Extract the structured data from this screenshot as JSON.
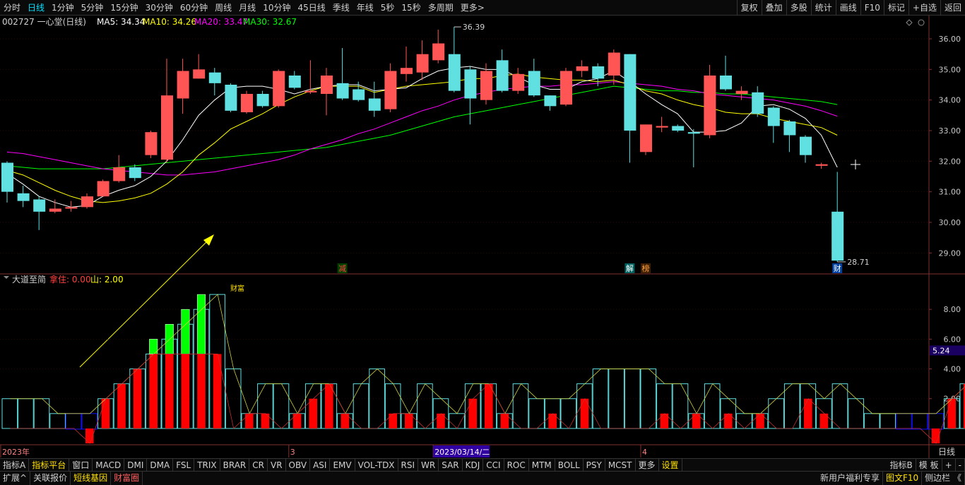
{
  "top_menu": [
    "分时",
    "日线",
    "1分钟",
    "5分钟",
    "15分钟",
    "30分钟",
    "60分钟",
    "周线",
    "月线",
    "10分钟",
    "45日线",
    "季线",
    "年线",
    "5秒",
    "15秒",
    "多周期",
    "更多>"
  ],
  "top_menu_active": "日线",
  "top_right": [
    "复权",
    "叠加",
    "多股",
    "统计",
    "画线",
    "F10",
    "标记",
    "+自选",
    "返回"
  ],
  "header": {
    "stock": "002727 一心堂(日线)",
    "ma5": "MA5: 34.34",
    "ma10": "MA10: 34.26",
    "ma20": "MA20: 33.47",
    "ma30": "MA30: 32.67"
  },
  "colors": {
    "up": "#ff5555",
    "down": "#60e0e0",
    "ma5": "#ffffff",
    "ma10": "#ffff00",
    "ma20": "#ff00ff",
    "ma30": "#00ff00",
    "red_bar": "#ff0000",
    "green_bar": "#00ff00",
    "blue_box": "#1010ff"
  },
  "chart_data": {
    "type": "candlestick",
    "price_axis": {
      "min": 28.5,
      "max": 36.3,
      "ticks": [
        "36.00",
        "35.00",
        "34.00",
        "33.00",
        "32.00",
        "31.00",
        "30.00",
        "29.00"
      ]
    },
    "high_label": "36.39",
    "low_label": "28.71",
    "candles": [
      {
        "o": 31.95,
        "c": 31.0,
        "h": 32.0,
        "l": 30.65
      },
      {
        "o": 30.95,
        "c": 30.7,
        "h": 31.2,
        "l": 30.5
      },
      {
        "o": 30.75,
        "c": 30.35,
        "h": 30.85,
        "l": 29.75
      },
      {
        "o": 30.35,
        "c": 30.45,
        "h": 30.75,
        "l": 30.3
      },
      {
        "o": 30.45,
        "c": 30.5,
        "h": 30.7,
        "l": 30.35
      },
      {
        "o": 30.5,
        "c": 30.85,
        "h": 30.95,
        "l": 30.45
      },
      {
        "o": 30.85,
        "c": 31.35,
        "h": 31.4,
        "l": 30.85
      },
      {
        "o": 31.35,
        "c": 31.8,
        "h": 32.2,
        "l": 31.3
      },
      {
        "o": 31.8,
        "c": 31.45,
        "h": 31.9,
        "l": 31.35
      },
      {
        "o": 32.2,
        "c": 32.95,
        "h": 33.0,
        "l": 32.1
      },
      {
        "o": 32.05,
        "c": 34.15,
        "h": 35.35,
        "l": 31.95
      },
      {
        "o": 34.05,
        "c": 34.95,
        "h": 35.35,
        "l": 33.55
      },
      {
        "o": 34.7,
        "c": 35.0,
        "h": 35.5,
        "l": 34.7
      },
      {
        "o": 34.9,
        "c": 34.55,
        "h": 35.05,
        "l": 34.15
      },
      {
        "o": 34.5,
        "c": 33.65,
        "h": 34.55,
        "l": 33.6
      },
      {
        "o": 33.6,
        "c": 34.2,
        "h": 34.3,
        "l": 33.55
      },
      {
        "o": 34.2,
        "c": 33.8,
        "h": 34.3,
        "l": 33.75
      },
      {
        "o": 33.8,
        "c": 34.95,
        "h": 35.0,
        "l": 33.75
      },
      {
        "o": 34.8,
        "c": 34.4,
        "h": 34.95,
        "l": 34.35
      },
      {
        "o": 34.25,
        "c": 34.3,
        "h": 35.3,
        "l": 34.2
      },
      {
        "o": 34.2,
        "c": 34.8,
        "h": 35.05,
        "l": 33.5
      },
      {
        "o": 34.55,
        "c": 34.05,
        "h": 35.7,
        "l": 34.0
      },
      {
        "o": 34.35,
        "c": 34.0,
        "h": 34.6,
        "l": 33.95
      },
      {
        "o": 34.05,
        "c": 33.65,
        "h": 34.6,
        "l": 33.45
      },
      {
        "o": 33.7,
        "c": 34.95,
        "h": 35.2,
        "l": 33.6
      },
      {
        "o": 34.85,
        "c": 35.05,
        "h": 35.75,
        "l": 34.6
      },
      {
        "o": 34.9,
        "c": 35.5,
        "h": 35.95,
        "l": 34.65
      },
      {
        "o": 35.3,
        "c": 35.85,
        "h": 36.3,
        "l": 35.2
      },
      {
        "o": 35.5,
        "c": 34.3,
        "h": 36.39,
        "l": 34.25
      },
      {
        "o": 35.0,
        "c": 34.05,
        "h": 35.1,
        "l": 33.2
      },
      {
        "o": 34.0,
        "c": 34.95,
        "h": 35.2,
        "l": 33.85
      },
      {
        "o": 35.3,
        "c": 34.3,
        "h": 35.65,
        "l": 34.25
      },
      {
        "o": 34.3,
        "c": 34.85,
        "h": 35.05,
        "l": 34.2
      },
      {
        "o": 34.95,
        "c": 34.15,
        "h": 35.35,
        "l": 34.1
      },
      {
        "o": 34.15,
        "c": 33.8,
        "h": 34.15,
        "l": 33.65
      },
      {
        "o": 33.85,
        "c": 34.95,
        "h": 35.05,
        "l": 33.8
      },
      {
        "o": 34.95,
        "c": 35.1,
        "h": 35.3,
        "l": 34.75
      },
      {
        "o": 35.1,
        "c": 34.7,
        "h": 35.2,
        "l": 34.45
      },
      {
        "o": 34.8,
        "c": 35.55,
        "h": 35.65,
        "l": 34.5
      },
      {
        "o": 35.5,
        "c": 33.0,
        "h": 35.5,
        "l": 31.95
      },
      {
        "o": 32.3,
        "c": 33.2,
        "h": 33.2,
        "l": 32.2
      },
      {
        "o": 33.1,
        "c": 33.15,
        "h": 33.45,
        "l": 32.95
      },
      {
        "o": 33.15,
        "c": 33.0,
        "h": 33.2,
        "l": 32.95
      },
      {
        "o": 32.95,
        "c": 32.9,
        "h": 33.05,
        "l": 31.8
      },
      {
        "o": 32.85,
        "c": 34.8,
        "h": 35.15,
        "l": 32.75
      },
      {
        "o": 34.8,
        "c": 34.35,
        "h": 35.45,
        "l": 34.3
      },
      {
        "o": 34.2,
        "c": 34.3,
        "h": 34.45,
        "l": 34.0
      },
      {
        "o": 34.25,
        "c": 33.55,
        "h": 34.45,
        "l": 33.45
      },
      {
        "o": 33.75,
        "c": 33.15,
        "h": 33.8,
        "l": 32.6
      },
      {
        "o": 33.3,
        "c": 32.85,
        "h": 33.35,
        "l": 32.3
      },
      {
        "o": 32.8,
        "c": 32.2,
        "h": 32.85,
        "l": 31.95
      },
      {
        "o": 31.85,
        "c": 31.9,
        "h": 31.95,
        "l": 31.75
      },
      {
        "o": 30.35,
        "c": 28.75,
        "h": 31.65,
        "l": 28.71
      }
    ],
    "ma5": [
      31.6,
      31.25,
      30.85,
      30.65,
      30.5,
      30.55,
      30.85,
      31.05,
      31.2,
      31.5,
      32.0,
      32.7,
      33.5,
      34.0,
      34.4,
      34.45,
      34.45,
      34.35,
      34.2,
      34.35,
      34.45,
      34.5,
      34.5,
      34.3,
      34.35,
      34.4,
      34.7,
      34.95,
      35.05,
      35.1,
      35.0,
      35.0,
      34.75,
      34.5,
      34.35,
      34.35,
      34.6,
      34.7,
      34.95,
      34.6,
      34.2,
      33.85,
      33.55,
      32.95,
      32.95,
      33.0,
      33.25,
      33.8,
      33.85,
      33.7,
      33.4,
      32.85,
      31.8
    ],
    "ma10": [
      31.7,
      31.55,
      31.3,
      31.05,
      30.85,
      30.7,
      30.65,
      30.7,
      30.8,
      30.95,
      31.25,
      31.65,
      32.2,
      32.6,
      33.05,
      33.3,
      33.55,
      33.85,
      34.1,
      34.3,
      34.45,
      34.45,
      34.45,
      34.25,
      34.35,
      34.45,
      34.5,
      34.55,
      34.6,
      34.7,
      34.7,
      34.8,
      34.85,
      34.75,
      34.7,
      34.65,
      34.65,
      34.6,
      34.65,
      34.5,
      34.3,
      34.2,
      34.0,
      33.85,
      33.75,
      33.6,
      33.55,
      33.55,
      33.4,
      33.3,
      33.2,
      33.1,
      32.85
    ],
    "ma20": [
      32.3,
      32.25,
      32.15,
      32.05,
      31.95,
      31.85,
      31.75,
      31.7,
      31.65,
      31.6,
      31.55,
      31.55,
      31.6,
      31.65,
      31.75,
      31.85,
      31.95,
      32.05,
      32.2,
      32.4,
      32.55,
      32.7,
      32.9,
      33.05,
      33.25,
      33.45,
      33.65,
      33.8,
      34.0,
      34.15,
      34.25,
      34.35,
      34.4,
      34.45,
      34.45,
      34.5,
      34.5,
      34.55,
      34.6,
      34.55,
      34.5,
      34.45,
      34.35,
      34.3,
      34.2,
      34.15,
      34.1,
      34.05,
      34.0,
      33.9,
      33.8,
      33.65,
      33.47
    ],
    "ma30": [
      31.85,
      31.8,
      31.75,
      31.75,
      31.75,
      31.75,
      31.75,
      31.8,
      31.85,
      31.9,
      31.95,
      32.0,
      32.05,
      32.1,
      32.15,
      32.2,
      32.25,
      32.3,
      32.35,
      32.4,
      32.45,
      32.55,
      32.65,
      32.75,
      32.85,
      33.0,
      33.15,
      33.3,
      33.45,
      33.55,
      33.65,
      33.75,
      33.85,
      33.95,
      34.05,
      34.15,
      34.25,
      34.35,
      34.45,
      34.4,
      34.35,
      34.3,
      34.3,
      34.25,
      34.25,
      34.2,
      34.2,
      34.15,
      34.1,
      34.05,
      34.0,
      33.95,
      33.85
    ],
    "event_markers": [
      {
        "index": 21,
        "label": "减",
        "color": "#ff4040",
        "bg": "#004000"
      },
      {
        "index": 39,
        "label": "解",
        "color": "#ffffff",
        "bg": "#006060"
      },
      {
        "index": 40,
        "label": "榜",
        "color": "#ffa040",
        "bg": "#402000"
      },
      {
        "index": 52,
        "label": "财",
        "color": "#ffffff",
        "bg": "#0040a0"
      }
    ],
    "indicator": {
      "name": "大道至简",
      "param1": "拿住: 0.00",
      "param2": "山: 2.00",
      "axis_ticks": [
        "8.00",
        "6.00",
        "4.00",
        "2.00"
      ],
      "current_value": "5.24",
      "annotation": "财富",
      "ylim": [
        -1,
        10
      ],
      "levels": [
        2,
        2,
        2,
        1,
        0,
        -1,
        2,
        3,
        4,
        5,
        6,
        7,
        8,
        9,
        4,
        1,
        3,
        3,
        1,
        3,
        3,
        1,
        3,
        4,
        3,
        1,
        3,
        2,
        1,
        3,
        3,
        1,
        3,
        2,
        2,
        2,
        3,
        4,
        4,
        4,
        4,
        3,
        3,
        1,
        3,
        2,
        1,
        1,
        2,
        3,
        3,
        2,
        3,
        2,
        1,
        1,
        0,
        0,
        -1,
        2,
        3,
        3,
        3,
        3,
        2,
        1,
        0,
        0,
        0
      ],
      "red": [
        0,
        0,
        0,
        0,
        0,
        -1,
        2,
        3,
        4,
        5,
        5,
        5,
        5,
        5,
        0,
        1,
        1,
        0,
        1,
        2,
        3,
        1,
        0,
        0,
        1,
        1,
        0,
        1,
        0,
        2,
        3,
        1,
        0,
        0,
        1,
        0,
        2,
        0,
        0,
        0,
        0,
        1,
        0,
        1,
        0,
        1,
        0,
        1,
        0,
        0,
        2,
        1,
        0,
        0,
        0,
        0,
        0,
        0,
        -1,
        2,
        3,
        0,
        0,
        0,
        0,
        0,
        0,
        0,
        0
      ],
      "green_top": [
        0,
        0,
        0,
        0,
        0,
        0,
        0,
        0,
        0,
        6,
        7,
        8,
        9,
        0,
        0,
        0,
        0,
        0,
        0,
        0,
        0,
        0,
        0,
        0,
        0,
        0,
        0,
        0,
        0,
        0,
        0,
        0,
        0,
        0,
        0,
        0,
        0,
        0,
        0,
        0,
        0,
        0,
        0,
        0,
        0,
        0,
        0,
        0,
        0,
        0,
        0,
        0,
        0,
        0,
        0,
        0,
        0,
        0,
        0,
        0,
        0,
        0,
        0,
        0,
        0,
        0,
        0,
        0,
        0
      ]
    },
    "x_axis": [
      {
        "index": 0,
        "label": "2023年"
      },
      {
        "index": 18,
        "label": "3"
      },
      {
        "index": 27,
        "label": "2023/03/14/二"
      },
      {
        "index": 40,
        "label": "4"
      }
    ],
    "x_axis_right": "日线"
  },
  "bottom_tabs": [
    "指标A",
    "指标平台",
    "窗口",
    "MACD",
    "DMI",
    "DMA",
    "FSL",
    "TRIX",
    "BRAR",
    "CR",
    "VR",
    "OBV",
    "ASI",
    "EMV",
    "VOL-TDX",
    "RSI",
    "WR",
    "SAR",
    "KDJ",
    "CCI",
    "ROC",
    "MTM",
    "BOLL",
    "PSY",
    "MCST",
    "更多",
    "设置"
  ],
  "bottom_tabs_right": [
    "指标B",
    "模 板",
    "+",
    "-"
  ],
  "bottom2_tabs": [
    "扩展^",
    "关联报价",
    "短线基因",
    "财富圈"
  ],
  "bottom2_right": [
    "新用户福利专享",
    "图文F10",
    "侧边栏 《"
  ]
}
